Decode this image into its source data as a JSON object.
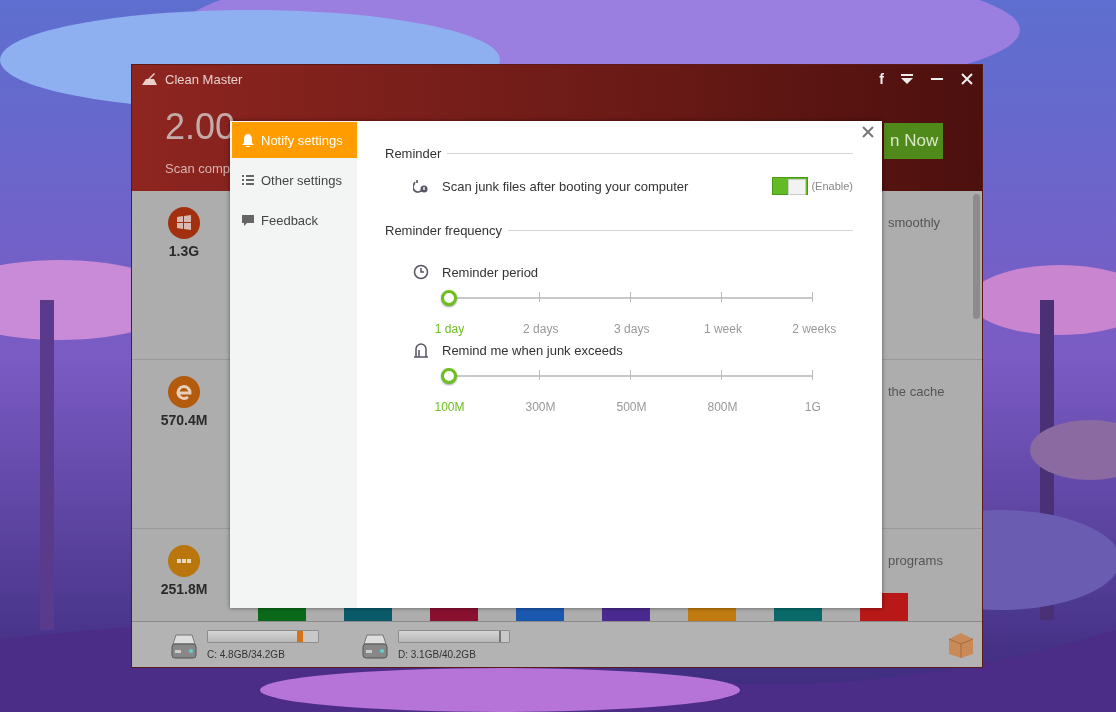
{
  "window": {
    "title": "Clean Master",
    "title_bar_text_buttons": [
      "f"
    ]
  },
  "header": {
    "junk_size": "2.00",
    "status": "Scan comp",
    "action_button": "n Now"
  },
  "categories": [
    {
      "size": "1.3G",
      "description": "smoothly"
    },
    {
      "size": "570.4M",
      "description": "the cache"
    },
    {
      "size": "251.8M",
      "description": "programs"
    }
  ],
  "drives": [
    {
      "label": "C: 4.8GB/34.2GB",
      "level": 0.86,
      "warning": true
    },
    {
      "label": "D: 3.1GB/40.2GB",
      "level": 0.93,
      "warning": false
    }
  ],
  "dialog": {
    "tabs": [
      {
        "label": "Notify settings",
        "selected": true
      },
      {
        "label": "Other settings",
        "selected": false
      },
      {
        "label": "Feedback",
        "selected": false
      }
    ],
    "sections": [
      {
        "title": "Reminder",
        "items": [
          {
            "kind": "toggle",
            "label": "Scan junk files after booting your computer",
            "on": true,
            "state_text": "(Enable)"
          }
        ]
      },
      {
        "title": "Reminder frequency",
        "items": [
          {
            "kind": "slider",
            "label": "Reminder period",
            "level": 0,
            "stops": [
              {
                "label": "1 day",
                "selected": true
              },
              {
                "label": "2 days",
                "selected": false
              },
              {
                "label": "3 days",
                "selected": false
              },
              {
                "label": "1 week",
                "selected": false
              },
              {
                "label": "2 weeks",
                "selected": false
              }
            ]
          },
          {
            "kind": "slider",
            "label": "Remind me when junk exceeds",
            "level": 0,
            "stops": [
              {
                "label": "100M",
                "selected": true
              },
              {
                "label": "300M",
                "selected": false
              },
              {
                "label": "500M",
                "selected": false
              },
              {
                "label": "800M",
                "selected": false
              },
              {
                "label": "1G",
                "selected": false
              }
            ]
          }
        ]
      }
    ]
  }
}
